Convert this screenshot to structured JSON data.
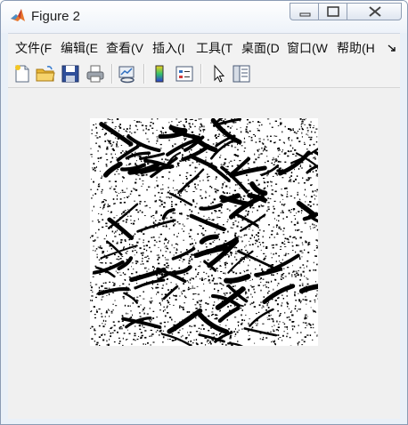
{
  "window": {
    "title": "Figure 2",
    "app_icon": "matlab-logo-icon",
    "controls": [
      "minimize-icon",
      "maximize-icon",
      "close-icon"
    ]
  },
  "menu": {
    "items": [
      {
        "label": "文件(F"
      },
      {
        "label": "编辑(E"
      },
      {
        "label": "查看(V"
      },
      {
        "label": "插入(I"
      },
      {
        "label": "工具(T"
      },
      {
        "label": "桌面(D"
      },
      {
        "label": "窗口(W"
      },
      {
        "label": "帮助(H"
      }
    ],
    "overflow_icon": "chevron-double-icon"
  },
  "toolbar": {
    "buttons": [
      {
        "icon": "new-figure-icon"
      },
      {
        "icon": "open-folder-icon"
      },
      {
        "icon": "save-icon"
      },
      {
        "icon": "print-icon"
      },
      {
        "icon": "link-plot-icon"
      },
      {
        "icon": "colorbar-icon"
      },
      {
        "icon": "legend-icon"
      },
      {
        "icon": "edit-plot-arrow-icon"
      },
      {
        "icon": "property-inspector-icon"
      }
    ]
  },
  "figure": {
    "content": "embossed-texture-image",
    "colors": {
      "foreground": "#000000",
      "background": "#ffffff",
      "canvas": "#f0f0f0"
    }
  }
}
